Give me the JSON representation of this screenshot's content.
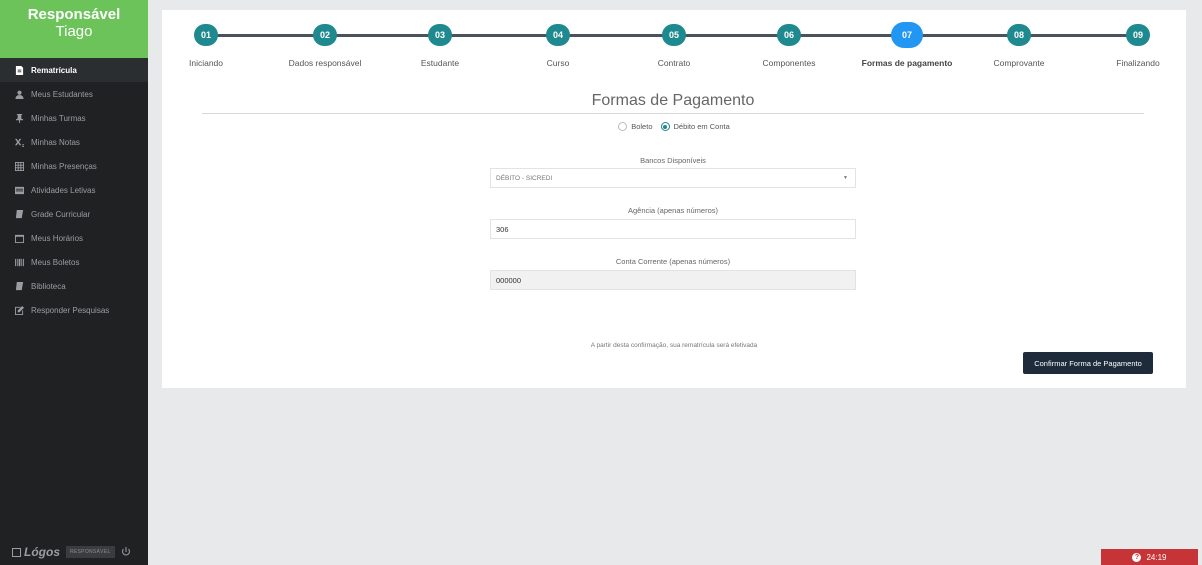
{
  "sidebar": {
    "user_role": "Responsável",
    "user_name": "Tiago",
    "items": [
      {
        "label": "Rematrícula",
        "icon": "file-icon",
        "active": true
      },
      {
        "label": "Meus Estudantes",
        "icon": "user-icon"
      },
      {
        "label": "Minhas Turmas",
        "icon": "pin-icon"
      },
      {
        "label": "Minhas Notas",
        "icon": "subscript-icon"
      },
      {
        "label": "Minhas Presenças",
        "icon": "grid-icon"
      },
      {
        "label": "Atividades Letivas",
        "icon": "list-icon"
      },
      {
        "label": "Grade Curricular",
        "icon": "book-icon"
      },
      {
        "label": "Meus Horários",
        "icon": "calendar-icon"
      },
      {
        "label": "Meus Boletos",
        "icon": "barcode-icon"
      },
      {
        "label": "Biblioteca",
        "icon": "book-icon"
      },
      {
        "label": "Responder Pesquisas",
        "icon": "edit-icon"
      }
    ],
    "footer": {
      "logo": "Lógos",
      "badge": "RESPONSÁVEL",
      "power_icon": "power-icon"
    }
  },
  "stepper": {
    "steps": [
      {
        "num": "01",
        "label": "Iniciando"
      },
      {
        "num": "02",
        "label": "Dados responsável"
      },
      {
        "num": "03",
        "label": "Estudante"
      },
      {
        "num": "04",
        "label": "Curso"
      },
      {
        "num": "05",
        "label": "Contrato"
      },
      {
        "num": "06",
        "label": "Componentes"
      },
      {
        "num": "07",
        "label": "Formas de pagamento"
      },
      {
        "num": "08",
        "label": "Comprovante"
      },
      {
        "num": "09",
        "label": "Finalizando"
      }
    ],
    "active_index": 6
  },
  "form": {
    "title": "Formas de Pagamento",
    "payment_options": {
      "boleto": "Boleto",
      "debito": "Débito em Conta",
      "selected": "debito"
    },
    "bank": {
      "label": "Bancos Disponíveis",
      "value": "DÉBITO - SICREDI"
    },
    "agency": {
      "label": "Agência (apenas números)",
      "value": "306"
    },
    "account": {
      "label": "Conta Corrente (apenas números)",
      "value": "000000"
    },
    "notice": "A partir desta confirmação, sua rematrícula será efetivada",
    "confirm_label": "Confirmar Forma de Pagamento"
  },
  "timer": {
    "value": "24:19"
  },
  "colors": {
    "accent": "#6bc35a",
    "step": "#1e8a8f",
    "step_active": "#2196f3",
    "button": "#1e2b3a",
    "timer": "#c73437"
  }
}
